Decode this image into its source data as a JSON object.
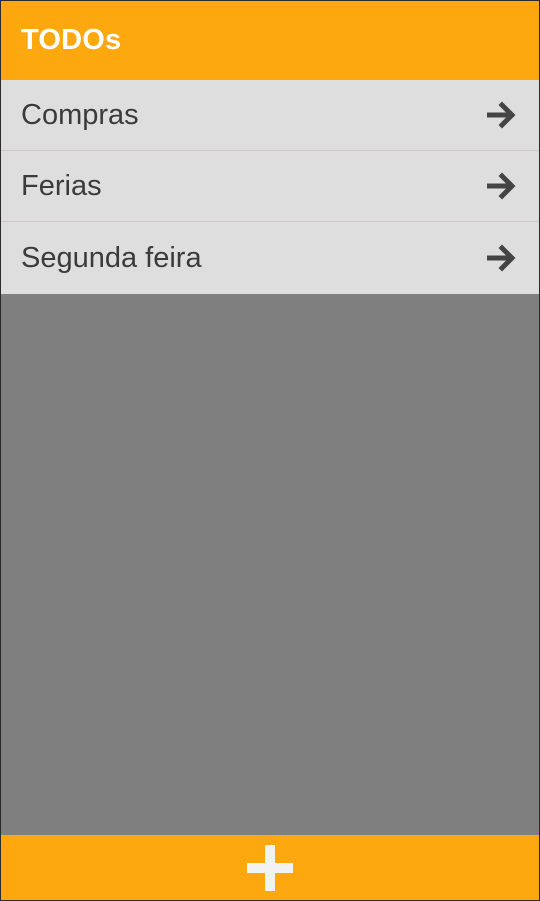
{
  "header": {
    "title": "TODOs"
  },
  "lists": [
    {
      "label": "Compras",
      "icon": "arrow-right-icon"
    },
    {
      "label": "Ferias",
      "icon": "arrow-right-icon"
    },
    {
      "label": "Segunda feira",
      "icon": "arrow-right-icon"
    }
  ],
  "footer": {
    "add_icon": "plus-icon"
  },
  "colors": {
    "accent": "#fda80e",
    "list_background": "#dedede",
    "body_background": "#7f7f7f",
    "text": "#3b3b3b",
    "header_text": "#ffffff"
  }
}
